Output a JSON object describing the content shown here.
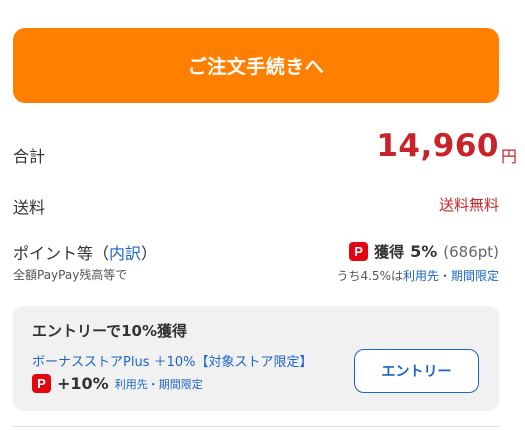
{
  "checkout_button": {
    "label": "ご注文手続きへ"
  },
  "summary": {
    "total_label": "合計",
    "total_value": "14,960",
    "total_unit": "円",
    "shipping_label": "送料",
    "shipping_value": "送料無料",
    "points_label": "ポイント等",
    "points_breakdown_open": "（",
    "points_breakdown_link": "内訳",
    "points_breakdown_close": "）",
    "points_sub": "全額PayPay残高等で",
    "earn_icon": "P",
    "earn_text": "獲得",
    "earn_rate": "5%",
    "earn_pts": "(686pt)",
    "note_prefix": "うち4.5%は",
    "note_link": "利用先・期間限定"
  },
  "entry_card": {
    "title": "エントリーで10%獲得",
    "link": "ボーナスストアPlus ＋10%【対象ストア限定】",
    "icon": "P",
    "rate": "+10%",
    "note": "利用先・期間限定",
    "button": "エントリー"
  },
  "colors": {
    "accent": "#ff8000",
    "price_red": "#c9232a",
    "link_blue": "#1a64c8",
    "paypay_red": "#e30512"
  },
  "icons": {
    "paypay": "paypay-icon"
  }
}
